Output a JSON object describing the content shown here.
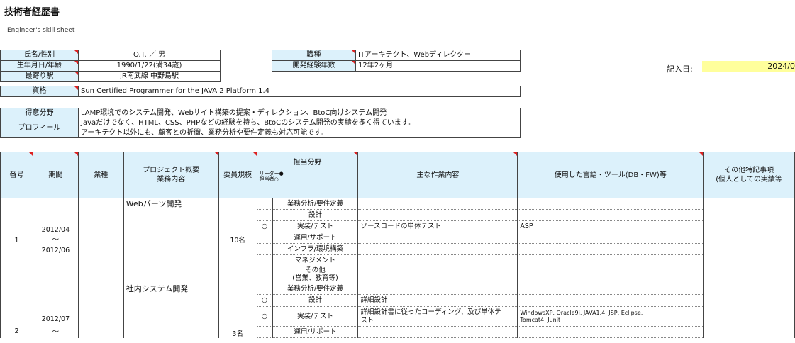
{
  "document": {
    "title": "技術者経歴書",
    "subtitle": "Engineer's skill sheet"
  },
  "profile": {
    "name_label": "氏名/性別",
    "name_value": "O.T. ／ 男",
    "birth_label": "生年月日/年齢",
    "birth_value": "1990/1/22(満34歳)",
    "station_label": "最寄り駅",
    "station_value": "JR南武線  中野島駅",
    "cert_label": "資格",
    "cert_value": "Sun Certified Programmer for the JAVA 2 Platform 1.4",
    "job_label": "職種",
    "job_value": "ITアーキテクト、Webディレクター",
    "years_label": "開発経験年数",
    "years_value": "12年2ヶ月",
    "date_label": "記入日:",
    "date_value": "2024/0"
  },
  "skills": {
    "specialty_label": "得意分野",
    "specialty_value": "LAMP環境でのシステム開発、Webサイト構築の提案・ディレクション、BtoC向けシステム開発",
    "profile_label": "プロフィール",
    "profile_line1": "Javaだけでなく、HTML、CSS、PHPなどの経験を持ち、BtoCのシステム開発の実績を多く得ています。",
    "profile_line2": "アーキテクト以外にも、顧客との折衝、業務分析や要件定義も対応可能です。"
  },
  "table": {
    "headers": {
      "no": "番号",
      "period": "期間",
      "industry": "業種",
      "project_line1": "プロジェクト概要",
      "project_line2": "業務内容",
      "size": "要員規模",
      "role": "担当分野",
      "role_legend1": "リーダー●",
      "role_legend2": "担当者○",
      "work": "主な作業内容",
      "tools": "使用した言語・ツール(DB・FW)等",
      "notes_line1": "その他特記事項",
      "notes_line2": "(個人としての実績等"
    },
    "rows": [
      {
        "no": "1",
        "period_from": "2012/04",
        "period_sep": "～",
        "period_to": "2012/06",
        "project": "Webパーツ開発",
        "size": "10名",
        "areas": [
          {
            "flag": "",
            "name": "業務分析/要件定義",
            "work": "",
            "tools": ""
          },
          {
            "flag": "",
            "name": "設計",
            "work": "",
            "tools": ""
          },
          {
            "flag": "○",
            "name": "実装/テスト",
            "work": "ソースコードの単体テスト",
            "tools": "ASP"
          },
          {
            "flag": "",
            "name": "運用/サポート",
            "work": "",
            "tools": ""
          },
          {
            "flag": "",
            "name": "インフラ/環境構築",
            "work": "",
            "tools": ""
          },
          {
            "flag": "",
            "name": "マネジメント",
            "work": "",
            "tools": ""
          },
          {
            "flag": "",
            "name": "その他",
            "name2": "(営業、教育等)",
            "work": "",
            "tools": ""
          }
        ]
      },
      {
        "no": "2",
        "period_from": "2012/07",
        "period_sep": "～",
        "project": "社内システム開発",
        "size": "3名",
        "areas": [
          {
            "flag": "",
            "name": "業務分析/要件定義",
            "work": "",
            "tools": ""
          },
          {
            "flag": "○",
            "name": "設計",
            "work": "詳細設計",
            "tools": ""
          },
          {
            "flag": "○",
            "name": "実装/テスト",
            "work": "詳細設計書に従ったコーディング、及び単体テ",
            "work2": "スト",
            "tools": "WindowsXP, Oracle9i, JAVA1.4, JSP, Eclipse,",
            "tools2": "Tomcat4, Junit"
          },
          {
            "flag": "",
            "name": "運用/サポート",
            "work": "",
            "tools": ""
          }
        ]
      }
    ]
  }
}
